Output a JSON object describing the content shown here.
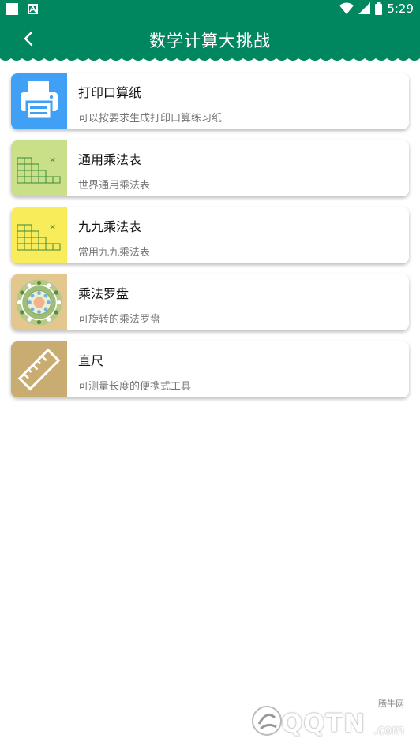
{
  "status_bar": {
    "time": "5:29"
  },
  "header": {
    "title": "数学计算大挑战"
  },
  "items": [
    {
      "title": "打印口算纸",
      "subtitle": "可以按要求生成打印口算练习纸",
      "icon": "printer-icon",
      "icon_bg": "#3fa0f5"
    },
    {
      "title": "通用乘法表",
      "subtitle": "世界通用乘法表",
      "icon": "multiplication-table-icon",
      "icon_bg": "#c9e088"
    },
    {
      "title": "九九乘法表",
      "subtitle": "常用九九乘法表",
      "icon": "multiplication-table-icon",
      "icon_bg": "#f9ec5b"
    },
    {
      "title": "乘法罗盘",
      "subtitle": "可旋转的乘法罗盘",
      "icon": "multiplication-compass-icon",
      "icon_bg": "#e2c88e"
    },
    {
      "title": "直尺",
      "subtitle": "可测量长度的便携式工具",
      "icon": "ruler-icon",
      "icon_bg": "#c9ac72"
    }
  ],
  "watermark": {
    "label": "腾牛网",
    "brand": "QQTN",
    "suffix": ".com"
  },
  "colors": {
    "primary": "#00875f"
  }
}
